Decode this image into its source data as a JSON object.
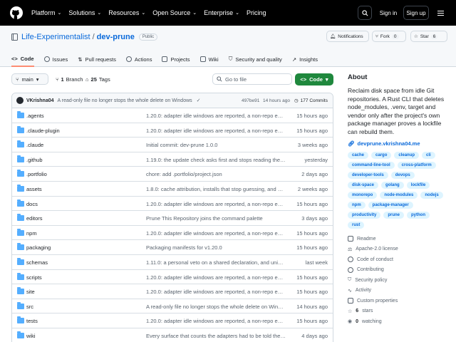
{
  "topbar": {
    "nav": [
      "Platform",
      "Solutions",
      "Resources",
      "Open Source",
      "Enterprise",
      "Pricing"
    ],
    "sign_in": "Sign in",
    "sign_up": "Sign up"
  },
  "repo": {
    "owner": "Life-Experimentalist",
    "name": "dev-prune",
    "visibility": "Public",
    "notifications": "Notifications",
    "fork_label": "Fork",
    "fork_count": "0",
    "star_label": "Star",
    "star_count": "6"
  },
  "tabs": [
    "Code",
    "Issues",
    "Pull requests",
    "Actions",
    "Projects",
    "Wiki",
    "Security and quality",
    "Insights"
  ],
  "toolbar": {
    "branch": "main",
    "branches_count": "1",
    "branches_label": "Branch",
    "tags_count": "25",
    "tags_label": "Tags",
    "goto_placeholder": "Go to file",
    "code_button": "Code"
  },
  "latest_commit": {
    "author": "VKrishna04",
    "message": "A read-only file no longer stops the whole delete on Windows",
    "hash": "497be91",
    "time": "14 hours ago",
    "commits": "177 Commits"
  },
  "files": [
    {
      "name": ".agents",
      "message": "1.20.0: adapter idle windows are reported, a non-repo entry ...",
      "time": "15 hours ago"
    },
    {
      "name": ".claude-plugin",
      "message": "1.20.0: adapter idle windows are reported, a non-repo entry ...",
      "time": "15 hours ago"
    },
    {
      "name": ".claude",
      "message": "Initial commit: dev-prune 1.0.0",
      "time": "3 weeks ago"
    },
    {
      "name": ".github",
      "message": "1.19.0: the update check asks first and stops reading the API",
      "time": "yesterday"
    },
    {
      "name": ".portfolio",
      "message": "chore: add .portfolio/project.json",
      "time": "2 days ago"
    },
    {
      "name": "assets",
      "message": "1.8.0: cache attribution, installs that stop guessing, and npm...",
      "time": "2 weeks ago"
    },
    {
      "name": "docs",
      "message": "1.20.0: adapter idle windows are reported, a non-repo entry ...",
      "time": "15 hours ago"
    },
    {
      "name": "editors",
      "message": "Prune This Repository joins the command palette",
      "time": "3 days ago"
    },
    {
      "name": "npm",
      "message": "1.20.0: adapter idle windows are reported, a non-repo entry ...",
      "time": "15 hours ago"
    },
    {
      "name": "packaging",
      "message": "Packaging manifests for v1.20.0",
      "time": "15 hours ago"
    },
    {
      "name": "schemas",
      "message": "1.11.0: a personal veto on a shared declaration, and uninsta...",
      "time": "last week"
    },
    {
      "name": "scripts",
      "message": "1.20.0: adapter idle windows are reported, a non-repo entry ...",
      "time": "15 hours ago"
    },
    {
      "name": "site",
      "message": "1.20.0: adapter idle windows are reported, a non-repo entry ...",
      "time": "15 hours ago"
    },
    {
      "name": "src",
      "message": "A read-only file no longer stops the whole delete on Windows",
      "time": "14 hours ago"
    },
    {
      "name": "tests",
      "message": "1.20.0: adapter idle windows are reported, a non-repo entry ...",
      "time": "15 hours ago"
    },
    {
      "name": "wiki",
      "message": "Every surface that counts the adapters had to be told there ...",
      "time": "4 days ago"
    }
  ],
  "about": {
    "heading": "About",
    "description": "Reclaim disk space from idle Git repositories. A Rust CLI that deletes node_modules, .venv, target and vendor only after the project's own package manager proves a lockfile can rebuild them.",
    "website": "devprune.vkrishna04.me",
    "topics": [
      "cache",
      "cargo",
      "cleanup",
      "cli",
      "command-line-tool",
      "cross-platform",
      "developer-tools",
      "devops",
      "disk-space",
      "golang",
      "lockfile",
      "monorepo",
      "node-modules",
      "nodejs",
      "npm",
      "package-manager",
      "productivity",
      "prune",
      "python",
      "rust"
    ],
    "readme": "Readme",
    "license": "Apache-2.0 license",
    "conduct": "Code of conduct",
    "contributing": "Contributing",
    "security": "Security policy",
    "activity": "Activity",
    "custom_properties": "Custom properties",
    "stars_count": "6",
    "stars_label": "stars",
    "watching_count": "0",
    "watching_label": "watching"
  },
  "colors": {
    "accent": "#0969da",
    "green": "#1f883d",
    "folder": "#54aeff",
    "tab_underline": "#fd8c73"
  }
}
